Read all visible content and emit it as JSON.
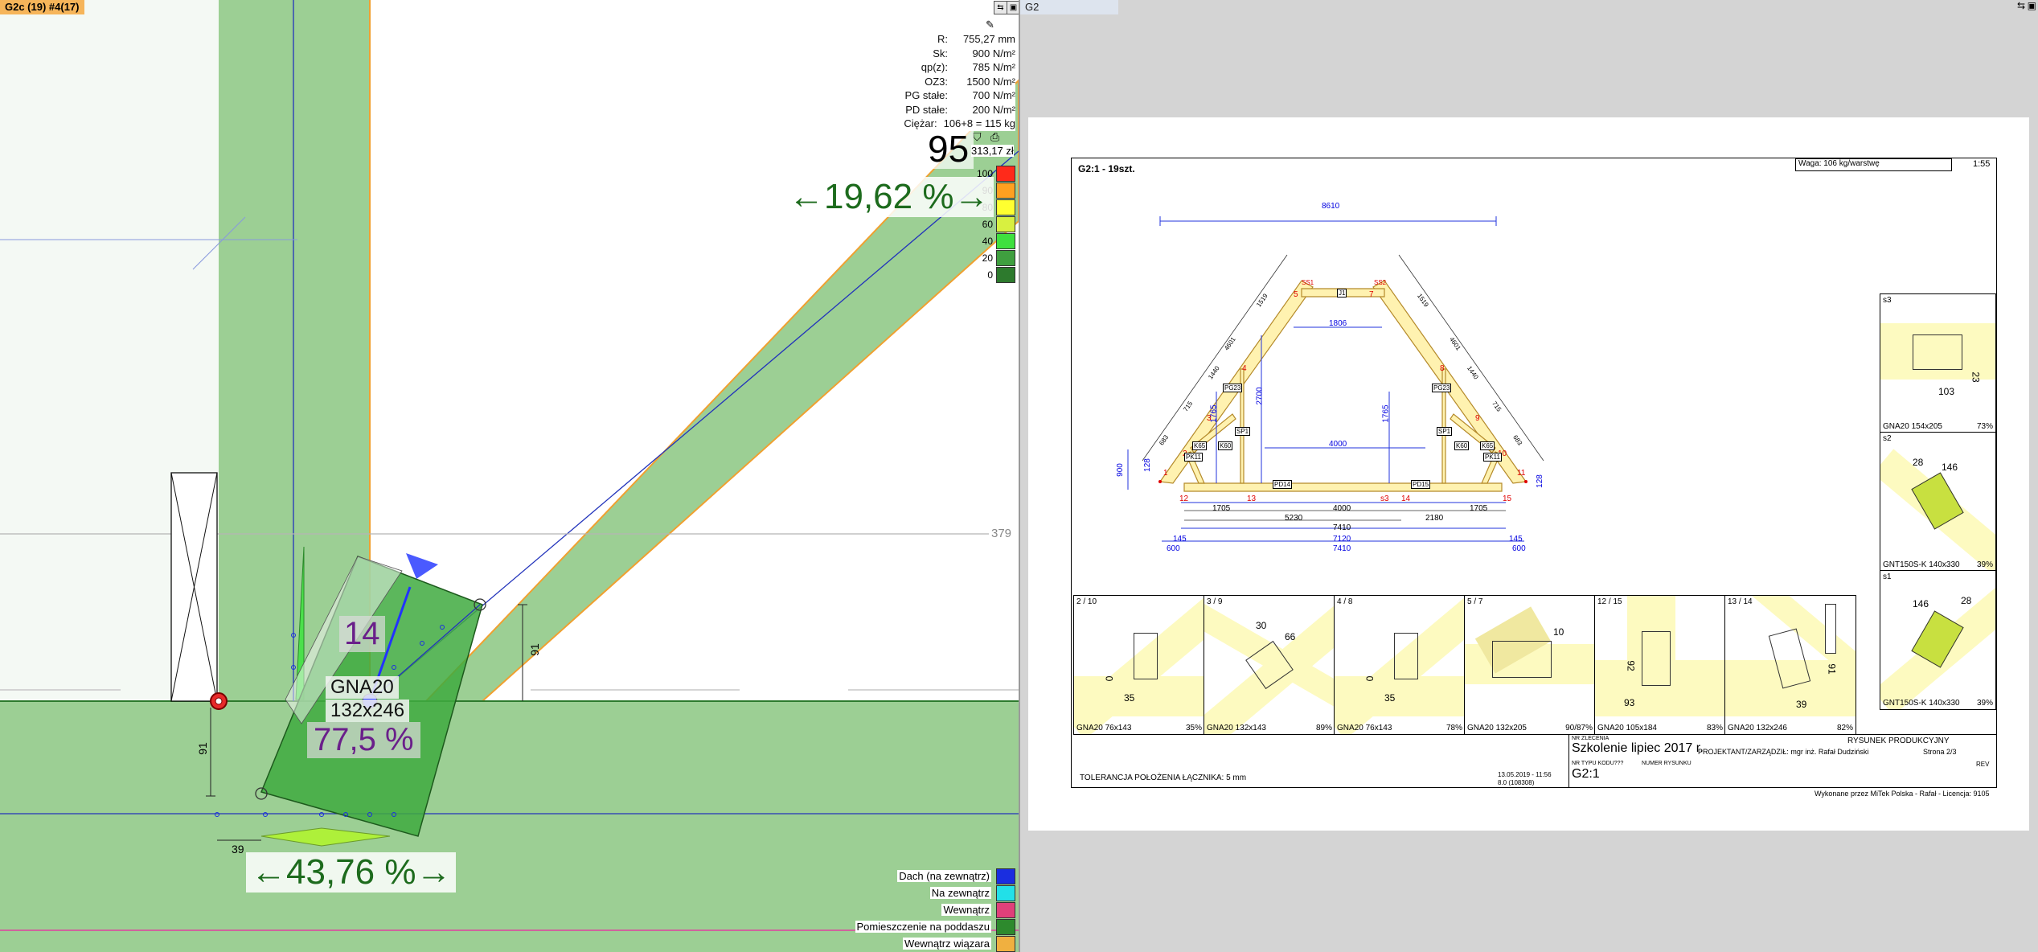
{
  "left_panel": {
    "title": "G2c (19) #4(17)",
    "params": [
      {
        "label": "R:",
        "value": "755,27 mm"
      },
      {
        "label": "Sk:",
        "value": "900 N/m²"
      },
      {
        "label": "qp(z):",
        "value": "785 N/m²"
      },
      {
        "label": "OZ3:",
        "value": "1500 N/m²"
      },
      {
        "label": "PG stałe:",
        "value": "700 N/m²"
      },
      {
        "label": "PD stałe:",
        "value": "200 N/m²"
      },
      {
        "label": "Ciężar:",
        "value": "106+8 = 115 kg"
      }
    ],
    "score": "95",
    "price": "313,17 zł",
    "scale": [
      {
        "label": "100",
        "color": "#ff2a1a"
      },
      {
        "label": "90",
        "color": "#ffa020"
      },
      {
        "label": "80",
        "color": "#ffff30"
      },
      {
        "label": "60",
        "color": "#d8f040"
      },
      {
        "label": "40",
        "color": "#3ee03e"
      },
      {
        "label": "20",
        "color": "#3f9f3f"
      },
      {
        "label": "0",
        "color": "#2d7a2d"
      }
    ],
    "pct_top": "←19,62 %→",
    "pct_bottom": "←43,76 %→",
    "plate_id": "14",
    "plate_name": "GNA20",
    "plate_size": "132x246",
    "plate_usage": "77,5 %",
    "dim_379": "379",
    "dim_91_right": "91",
    "dim_91_left": "91",
    "dim_39": "39",
    "legend": [
      {
        "label": "Dach (na zewnątrz)",
        "color": "#1a2ee0"
      },
      {
        "label": "Na zewnątrz",
        "color": "#22e0e8"
      },
      {
        "label": "Wewnątrz",
        "color": "#e0407a"
      },
      {
        "label": "Pomieszczenie na poddaszu",
        "color": "#2d8a2d"
      },
      {
        "label": "Wewnątrz wiązara",
        "color": "#f0b040"
      }
    ]
  },
  "right_panel": {
    "title": "G2",
    "sheet": {
      "heading": "G2:1 - 19szt.",
      "weight": "Waga: 106 kg/warstwę",
      "scale": "1:55",
      "dims": {
        "top": "8610",
        "d1806": "1806",
        "d2700": "2700",
        "d4000": "4000",
        "d1765a": "1765",
        "d1765b": "1765",
        "b1705a": "1705",
        "b4000": "4000",
        "b1705b": "1705",
        "b5230": "5230",
        "b2180": "2180",
        "b7410": "7410",
        "b7120": "7120",
        "b7410b": "7410",
        "b600a": "600",
        "b600b": "600",
        "b145a": "145",
        "b145b": "145",
        "h900": "900",
        "l683": "683",
        "l715": "715",
        "l1440": "1440",
        "l4601": "4601",
        "l1519": "1519",
        "r1519": "1519",
        "r4601": "4601",
        "r1440": "1440",
        "r715": "715",
        "r683": "683",
        "h128a": "128",
        "h128b": "128"
      },
      "nodes": [
        "1",
        "2",
        "3",
        "4",
        "5",
        "6",
        "7",
        "8",
        "9",
        "10",
        "11",
        "12",
        "13",
        "s3",
        "14",
        "15"
      ],
      "members": {
        "pg23a": "PG23",
        "pg23b": "PG23",
        "sp1a": "SP1",
        "sp1b": "SP1",
        "j1": "J1",
        "k65a": "K65",
        "k65b": "K65",
        "k60a": "K60",
        "k60b": "K60",
        "pk11a": "PK11",
        "pk11b": "PK11",
        "pd14": "PD14",
        "pd15": "PD15",
        "ss1": "SS1",
        "ss2": "SS2"
      },
      "side_details": [
        {
          "title": "s3",
          "plate": "GNA20 154x205",
          "pct": "73%",
          "d1": "103",
          "d2": "23"
        },
        {
          "title": "s2",
          "plate": "GNT150S-K 140x330",
          "pct": "39%",
          "d1": "28",
          "d2": "146"
        },
        {
          "title": "s1",
          "plate": "GNT150S-K 140x330",
          "pct": "39%",
          "d1": "146",
          "d2": "28"
        }
      ],
      "bottom_details": [
        {
          "title": "2 / 10",
          "plate": "GNA20 76x143",
          "pct": "35%",
          "d1": "35",
          "d2": "0"
        },
        {
          "title": "3 / 9",
          "plate": "GNA20 132x143",
          "pct": "89%",
          "d1": "30",
          "d2": "66"
        },
        {
          "title": "4 / 8",
          "plate": "GNA20 76x143",
          "pct": "78%",
          "d1": "35",
          "d2": "0"
        },
        {
          "title": "5 / 7",
          "plate": "GNA20 132x205",
          "pct": "90/87%",
          "d1": "10",
          "d2": ""
        },
        {
          "title": "12 / 15",
          "plate": "GNA20 105x184",
          "pct": "83%",
          "d1": "93",
          "d2": "92"
        },
        {
          "title": "13 / 14",
          "plate": "GNA20 132x246",
          "pct": "82%",
          "d1": "39",
          "d2": "91"
        }
      ],
      "tolerance": "TOLERANCJA POŁOŻENIA ŁĄCZNIKA: 5 mm",
      "tb_order_label": "NR ZLECENIA",
      "tb_order": "Szkolenie lipiec 2017 r.",
      "tb_date": "13.05.2019 - 11:56",
      "tb_version": "8.0 (108308)",
      "tb_type_label": "NR TYPU KODU???",
      "tb_drawing_label": "NUMER RYSUNKU",
      "tb_drawing": "G2:1",
      "tb_designer": "PROJEKTANT/ZARZĄDZIŁ: mgr inż. Rafał Dudziński",
      "tb_kind": "RYSUNEK PRODUKCYJNY",
      "tb_page": "Strona 2/3",
      "tb_rev": "REV",
      "footer": "Wykonane przez MiTek Polska - Rafał - Licencja: 9105"
    }
  }
}
